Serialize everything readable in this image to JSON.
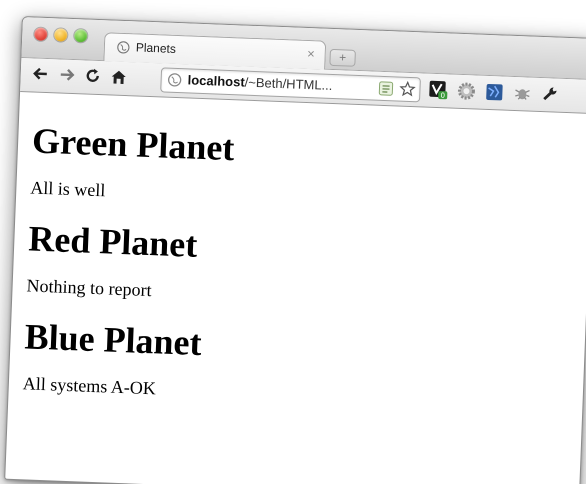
{
  "window": {
    "tab_title": "Planets",
    "tab_close": "×",
    "new_tab": "+",
    "url_host": "localhost",
    "url_path": "/~Beth/HTML...",
    "toolbar_icons": {
      "back": "arrow-left-icon",
      "forward": "arrow-right-icon",
      "reload": "reload-icon",
      "home": "home-icon",
      "bookmark_star": "star-icon",
      "extensions": [
        "evernote-icon",
        "gear-extension-icon",
        "puzzle-extension-icon",
        "bug-extension-icon",
        "wrench-icon"
      ]
    },
    "colors": {
      "close": "#e0443a",
      "minimize": "#f0b429",
      "zoom": "#5fbf37"
    },
    "extension_badge": "0"
  },
  "page": {
    "sections": [
      {
        "title": "Green Planet",
        "description": "All is well"
      },
      {
        "title": "Red Planet",
        "description": "Nothing to report"
      },
      {
        "title": "Blue Planet",
        "description": "All systems A-OK"
      }
    ]
  }
}
